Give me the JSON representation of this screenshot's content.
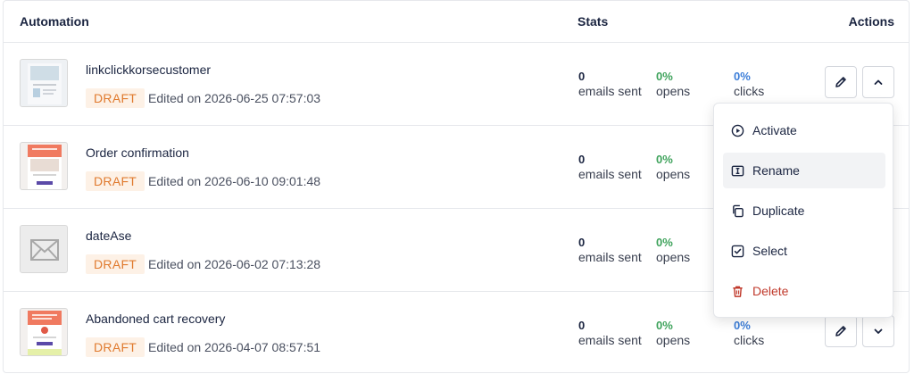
{
  "header": {
    "automation": "Automation",
    "stats": "Stats",
    "actions": "Actions"
  },
  "rows": [
    {
      "name": "linkclickkorsecustomer",
      "status": "DRAFT",
      "edited": "Edited on 2026-06-25 07:57:03",
      "emails_sent": "0",
      "emails_sent_label": "emails sent",
      "opens": "0%",
      "opens_label": "opens",
      "clicks": "0%",
      "clicks_label": "clicks"
    },
    {
      "name": "Order confirmation",
      "status": "DRAFT",
      "edited": "Edited on 2026-06-10 09:01:48",
      "emails_sent": "0",
      "emails_sent_label": "emails sent",
      "opens": "0%",
      "opens_label": "opens",
      "clicks": "",
      "clicks_label": ""
    },
    {
      "name": "dateAse",
      "status": "DRAFT",
      "edited": "Edited on 2026-06-02 07:13:28",
      "emails_sent": "0",
      "emails_sent_label": "emails sent",
      "opens": "0%",
      "opens_label": "opens",
      "clicks": "",
      "clicks_label": ""
    },
    {
      "name": "Abandoned cart recovery",
      "status": "DRAFT",
      "edited": "Edited on 2026-04-07 08:57:51",
      "emails_sent": "0",
      "emails_sent_label": "emails sent",
      "opens": "0%",
      "opens_label": "opens",
      "clicks": "0%",
      "clicks_label": "clicks"
    }
  ],
  "menu": {
    "activate": "Activate",
    "rename": "Rename",
    "duplicate": "Duplicate",
    "select": "Select",
    "delete": "Delete"
  },
  "colors": {
    "draft_text": "#e07a2e",
    "draft_bg": "#fdf1e6",
    "opens": "#3fa35c",
    "clicks": "#3b7dd8",
    "delete": "#c0392b"
  }
}
